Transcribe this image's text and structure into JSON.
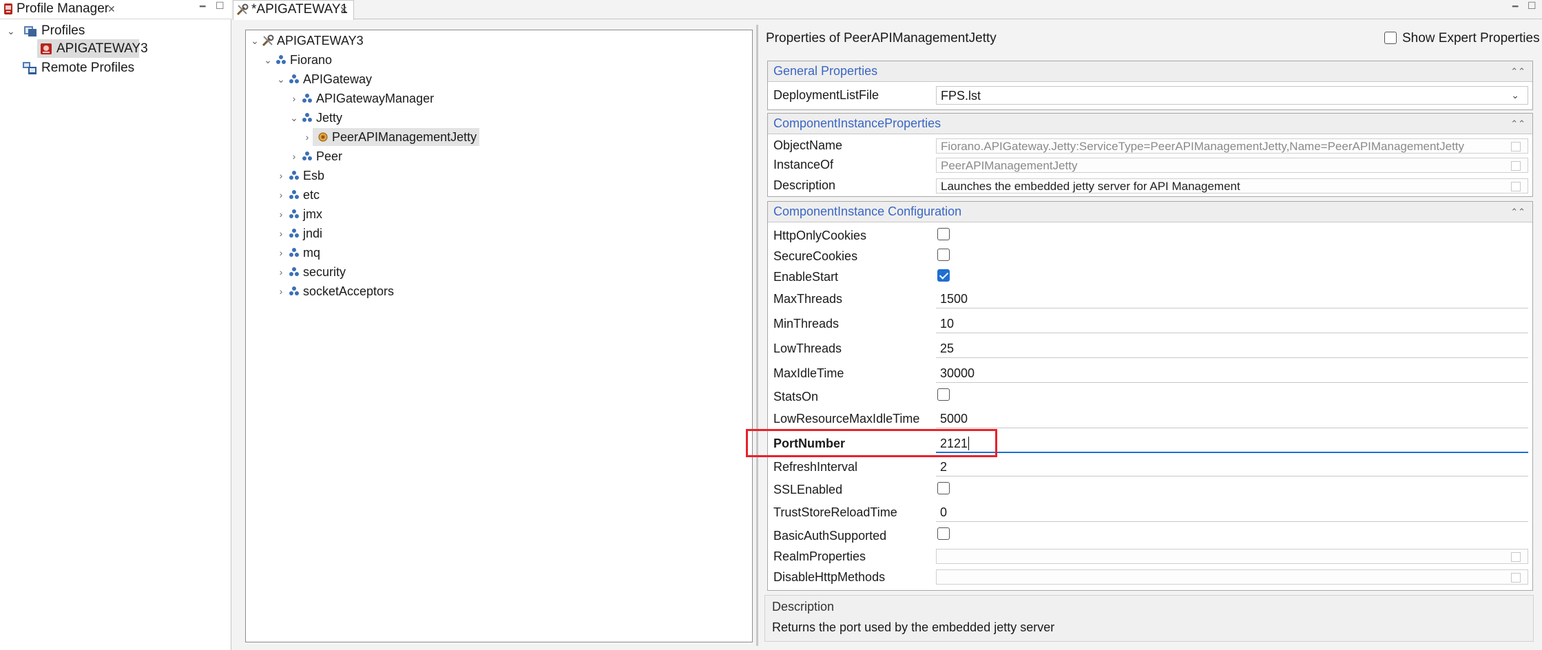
{
  "profile_manager": {
    "tab_title": "Profile Manager",
    "tree": {
      "root_label": "Profiles",
      "selected_label": "APIGATEWAY3",
      "remote_label": "Remote Profiles"
    }
  },
  "editor": {
    "tab_title": "*APIGATEWAY1",
    "tree": {
      "root": "APIGATEWAY3",
      "fiorano": "Fiorano",
      "apigateway": "APIGateway",
      "apigateway_manager": "APIGatewayManager",
      "jetty": "Jetty",
      "peer_api_mgmt_jetty": "PeerAPIManagementJetty",
      "peer": "Peer",
      "esb": "Esb",
      "etc": "etc",
      "jmx": "jmx",
      "jndi": "jndi",
      "mq": "mq",
      "security": "security",
      "socket_acceptors": "socketAcceptors"
    }
  },
  "properties": {
    "title": "Properties of PeerAPIManagementJetty",
    "show_expert_label": "Show Expert Properties",
    "show_expert_checked": false,
    "general": {
      "header": "General Properties",
      "deployment_list_label": "DeploymentListFile",
      "deployment_list_value": "FPS.lst"
    },
    "instance_props": {
      "header": "ComponentInstanceProperties",
      "object_name_label": "ObjectName",
      "object_name_value": "Fiorano.APIGateway.Jetty:ServiceType=PeerAPIManagementJetty,Name=PeerAPIManagementJetty",
      "instance_of_label": "InstanceOf",
      "instance_of_value": "PeerAPIManagementJetty",
      "description_label": "Description",
      "description_value": "Launches the embedded jetty server for API Management"
    },
    "config": {
      "header": "ComponentInstance Configuration",
      "http_only_cookies": "HttpOnlyCookies",
      "secure_cookies": "SecureCookies",
      "enable_start": "EnableStart",
      "enable_start_checked": true,
      "max_threads": "MaxThreads",
      "max_threads_value": "1500",
      "min_threads": "MinThreads",
      "min_threads_value": "10",
      "low_threads": "LowThreads",
      "low_threads_value": "25",
      "max_idle_time": "MaxIdleTime",
      "max_idle_time_value": "30000",
      "stats_on": "StatsOn",
      "low_resource_max_idle": "LowResourceMaxIdleTime",
      "low_resource_max_idle_value": "5000",
      "port_number": "PortNumber",
      "port_number_value": "2121",
      "refresh_interval": "RefreshInterval",
      "refresh_interval_value": "2",
      "ssl_enabled": "SSLEnabled",
      "truststore_reload": "TrustStoreReloadTime",
      "truststore_reload_value": "0",
      "basic_auth": "BasicAuthSupported",
      "realm_properties": "RealmProperties",
      "disable_http_methods": "DisableHttpMethods"
    },
    "description_panel": {
      "title": "Description",
      "text": "Returns the port used by the embedded jetty server"
    }
  },
  "colors": {
    "accent_blue": "#3a66c4",
    "checkbox_checked": "#1f6fd1",
    "highlight_red": "#e8212a"
  }
}
